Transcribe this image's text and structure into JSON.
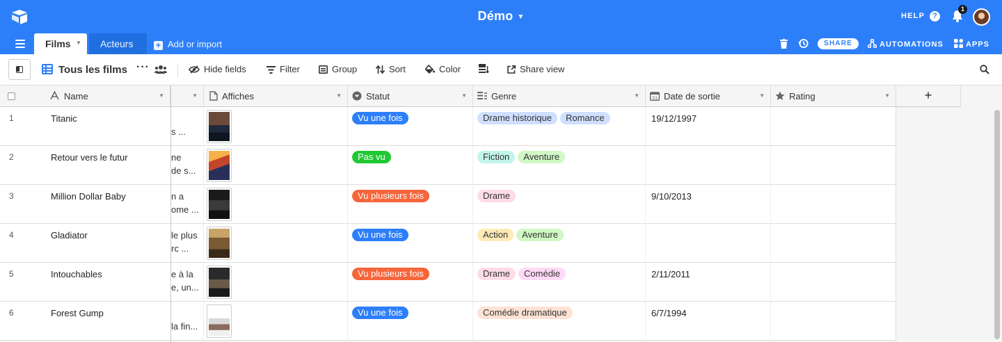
{
  "app": {
    "base_name": "Démo",
    "help": "HELP",
    "notif_count": "1"
  },
  "tabs": {
    "active": "Films",
    "other": "Acteurs",
    "add_import": "Add or import"
  },
  "topright": {
    "share": "SHARE",
    "automations": "AUTOMATIONS",
    "apps": "APPS"
  },
  "toolbar": {
    "view_name": "Tous les films",
    "hide_fields": "Hide fields",
    "filter": "Filter",
    "group": "Group",
    "sort": "Sort",
    "color": "Color",
    "share_view": "Share view"
  },
  "columns": {
    "name": "Name",
    "affiches": "Affiches",
    "statut": "Statut",
    "genre": "Genre",
    "date": "Date de sortie",
    "rating": "Rating"
  },
  "colors": {
    "brand": "#2d7ff9",
    "status_blue": "#2d7ff9",
    "status_green": "#20c933",
    "status_orange": "#f7653b",
    "genre_blue": "#cfdfff",
    "genre_teal": "#c2f5e9",
    "genre_green": "#d1f7c4",
    "genre_pink": "#ffdaf6",
    "genre_rose": "#ffdce5",
    "genre_yellow": "#ffeab6",
    "genre_orange": "#fee2d5"
  },
  "rows": [
    {
      "num": "1",
      "name": "Titanic",
      "desc": [
        "",
        "s ..."
      ],
      "poster": "titanic-poster",
      "statut": "Vu une fois",
      "statut_color": "blue",
      "genres": [
        {
          "label": "Drame historique",
          "color": "genre_blue"
        },
        {
          "label": "Romance",
          "color": "genre_blue"
        }
      ],
      "date": "19/12/1997"
    },
    {
      "num": "2",
      "name": "Retour vers le futur",
      "desc": [
        "ne",
        "de s..."
      ],
      "poster": "back-to-future-poster",
      "statut": "Pas vu",
      "statut_color": "green",
      "genres": [
        {
          "label": "Fiction",
          "color": "genre_teal"
        },
        {
          "label": "Aventure",
          "color": "genre_green"
        }
      ],
      "date": ""
    },
    {
      "num": "3",
      "name": "Million Dollar Baby",
      "desc": [
        "n a",
        "ome ..."
      ],
      "poster": "million-dollar-baby-poster",
      "statut": "Vu plusieurs fois",
      "statut_color": "orange",
      "genres": [
        {
          "label": "Drame",
          "color": "genre_rose"
        }
      ],
      "date": "9/10/2013"
    },
    {
      "num": "4",
      "name": "Gladiator",
      "desc": [
        "le plus",
        "rc ..."
      ],
      "poster": "gladiator-poster",
      "statut": "Vu une fois",
      "statut_color": "blue",
      "genres": [
        {
          "label": "Action",
          "color": "genre_yellow"
        },
        {
          "label": "Aventure",
          "color": "genre_green"
        }
      ],
      "date": ""
    },
    {
      "num": "5",
      "name": "Intouchables",
      "desc": [
        "e à la",
        "e, un..."
      ],
      "poster": "intouchables-poster",
      "statut": "Vu plusieurs fois",
      "statut_color": "orange",
      "genres": [
        {
          "label": "Drame",
          "color": "genre_rose"
        },
        {
          "label": "Comédie",
          "color": "genre_pink"
        }
      ],
      "date": "2/11/2011"
    },
    {
      "num": "6",
      "name": "Forest Gump",
      "desc": [
        "",
        "la fin..."
      ],
      "poster": "forrest-gump-poster",
      "statut": "Vu une fois",
      "statut_color": "blue",
      "genres": [
        {
          "label": "Comédie dramatique",
          "color": "genre_orange"
        }
      ],
      "date": "6/7/1994"
    }
  ]
}
